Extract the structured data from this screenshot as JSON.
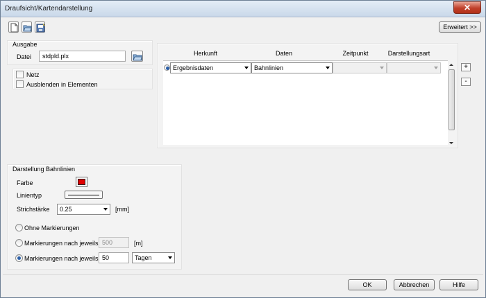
{
  "window": {
    "title": "Draufsicht/Kartendarstellung",
    "close_glyph": "✕"
  },
  "toolbar": {
    "icons": [
      "new-document-icon",
      "open-folder-icon",
      "save-icon"
    ],
    "expand_label": "Erweitert >>"
  },
  "ausgabe": {
    "legend": "Ausgabe",
    "file_label": "Datei",
    "file_value": "stdpld.plx",
    "browse_icon": "open-folder-icon"
  },
  "options": {
    "netz_label": "Netz",
    "ausblenden_label": "Ausblenden in Elementen"
  },
  "grid": {
    "headers": [
      "Herkunft",
      "Daten",
      "Zeitpunkt",
      "Darstellungsart"
    ],
    "row": {
      "herkunft": "Ergebnisdaten",
      "daten": "Bahnlinien",
      "zeitpunkt": "",
      "darstellungsart": ""
    },
    "add_glyph": "+",
    "remove_glyph": "-"
  },
  "darstellung": {
    "legend": "Darstellung Bahnlinien",
    "farbe_label": "Farbe",
    "farbe_color": "#e00000",
    "linientyp_label": "Linientyp",
    "strichstaerke_label": "Strichstärke",
    "strichstaerke_value": "0.25",
    "strichstaerke_unit": "[mm]",
    "radio_none": "Ohne Markierungen",
    "radio_m_label": "Markierungen nach jeweils",
    "radio_m_value": "500",
    "radio_m_unit": "[m]",
    "radio_t_label": "Markierungen nach jeweils",
    "radio_t_value": "50",
    "radio_t_unit": "Tagen"
  },
  "footer": {
    "ok": "OK",
    "cancel": "Abbrechen",
    "help": "Hilfe"
  }
}
